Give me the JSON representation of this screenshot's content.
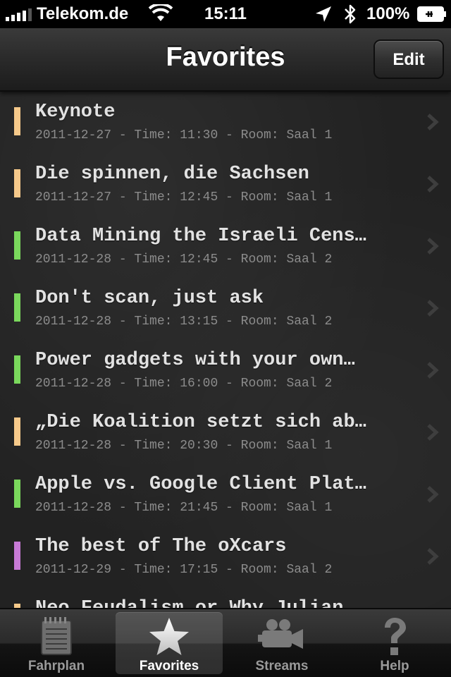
{
  "status_bar": {
    "carrier": "Telekom.de",
    "time": "15:11",
    "battery": "100%"
  },
  "nav": {
    "title": "Favorites",
    "edit_label": "Edit"
  },
  "colors": {
    "track_orange": "#f6c98a",
    "track_green": "#7ad85c",
    "track_purple": "#c77ad6"
  },
  "favorites": [
    {
      "title": "Keynote",
      "subtitle": "2011-12-27 - Time: 11:30 - Room: Saal 1",
      "color": "#f6c98a"
    },
    {
      "title": "Die spinnen, die Sachsen",
      "subtitle": "2011-12-27 - Time: 12:45 - Room: Saal 1",
      "color": "#f6c98a"
    },
    {
      "title": "Data Mining the Israeli Cens…",
      "subtitle": "2011-12-28 - Time: 12:45 - Room: Saal 2",
      "color": "#7ad85c"
    },
    {
      "title": "Don't scan, just ask",
      "subtitle": "2011-12-28 - Time: 13:15 - Room: Saal 2",
      "color": "#7ad85c"
    },
    {
      "title": "Power gadgets with your own…",
      "subtitle": "2011-12-28 - Time: 16:00 - Room: Saal 2",
      "color": "#7ad85c"
    },
    {
      "title": "„Die Koalition setzt sich ab…",
      "subtitle": "2011-12-28 - Time: 20:30 - Room: Saal 1",
      "color": "#f6c98a"
    },
    {
      "title": "Apple vs. Google Client Plat…",
      "subtitle": "2011-12-28 - Time: 21:45 - Room: Saal 1",
      "color": "#7ad85c"
    },
    {
      "title": "The best of The oXcars",
      "subtitle": "2011-12-29 - Time: 17:15 - Room: Saal 2",
      "color": "#c77ad6"
    },
    {
      "title": "Neo Feudalism or Why Julian…",
      "subtitle": "",
      "color": "#f6c98a"
    }
  ],
  "tabs": [
    {
      "label": "Fahrplan",
      "icon": "notepad-icon",
      "active": false
    },
    {
      "label": "Favorites",
      "icon": "star-icon",
      "active": true
    },
    {
      "label": "Streams",
      "icon": "video-camera-icon",
      "active": false
    },
    {
      "label": "Help",
      "icon": "question-mark-icon",
      "active": false
    }
  ]
}
